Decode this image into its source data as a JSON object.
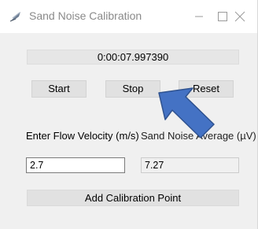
{
  "window": {
    "title": "Sand Noise Calibration",
    "controls": {
      "minimize": "minimize-icon",
      "maximize": "maximize-icon",
      "close": "close-icon"
    }
  },
  "timer": {
    "value": "0:00:07.997390"
  },
  "buttons": {
    "start": "Start",
    "stop": "Stop",
    "reset": "Reset",
    "add_point": "Add Calibration Point"
  },
  "flow": {
    "label": "Enter Flow Velocity (m/s)",
    "value": "2.7"
  },
  "noise": {
    "label": "Sand Noise Average (µV)",
    "value": "7.27"
  },
  "colors": {
    "arrow_fill": "#4472c4",
    "arrow_stroke": "#2f528f"
  },
  "icons": {
    "app": "feather-icon",
    "pointer": "pointer-arrow-icon"
  }
}
